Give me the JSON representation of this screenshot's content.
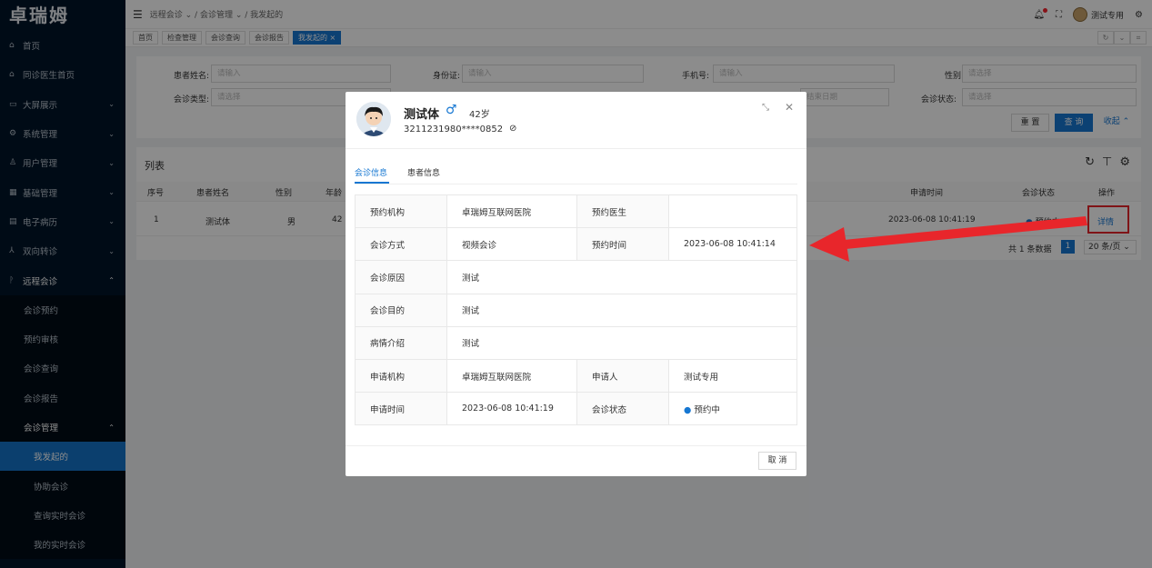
{
  "app": {
    "logo": "卓瑞姆"
  },
  "sidebar": {
    "items": [
      {
        "label": "首页",
        "icon": "home-icon"
      },
      {
        "label": "同诊医生首页",
        "icon": "home-icon"
      },
      {
        "label": "大屏展示",
        "icon": "monitor-icon"
      },
      {
        "label": "系统管理",
        "icon": "gear-icon"
      },
      {
        "label": "用户管理",
        "icon": "user-icon"
      },
      {
        "label": "基础管理",
        "icon": "grid-icon"
      },
      {
        "label": "电子病历",
        "icon": "record-icon"
      },
      {
        "label": "双向转诊",
        "icon": "transfer-icon"
      },
      {
        "label": "远程会诊",
        "icon": "branch-icon"
      },
      {
        "label": "会诊预约"
      },
      {
        "label": "预约审核"
      },
      {
        "label": "会诊查询"
      },
      {
        "label": "会诊报告"
      },
      {
        "label": "会诊管理"
      },
      {
        "label": "我发起的"
      },
      {
        "label": "协助会诊"
      },
      {
        "label": "查询实时会诊"
      },
      {
        "label": "我的实时会诊"
      }
    ]
  },
  "topbar": {
    "breadcrumb": [
      "远程会诊",
      "会诊管理",
      "我发起的"
    ],
    "username": "测试专用"
  },
  "tabs": [
    "首页",
    "检查管理",
    "会诊查询",
    "会诊报告",
    "我发起的"
  ],
  "search": {
    "patient_name_label": "患者姓名:",
    "id_label": "身份证:",
    "phone_label": "手机号:",
    "gender_label": "性别:",
    "type_label": "会诊类型:",
    "status_label": "会诊状态:",
    "input_placeholder": "请输入",
    "select_placeholder": "请选择",
    "end_date_placeholder": "结束日期",
    "reset": "重 置",
    "query": "查 询",
    "collapse": "收起"
  },
  "list": {
    "title": "列表",
    "headers": [
      "序号",
      "患者姓名",
      "性别",
      "年龄",
      "申请时间",
      "会诊状态",
      "操作"
    ],
    "row": {
      "index": "1",
      "name": "测试体",
      "gender": "男",
      "age": "42",
      "apply_time": "2023-06-08 10:41:19",
      "status": "预约中",
      "action": "详情"
    },
    "total": "共 1 条数据",
    "page": "1",
    "page_size": "20 条/页"
  },
  "modal": {
    "name": "测试体",
    "age": "42岁",
    "id_number": "3211231980****0852",
    "tabs": [
      "会诊信息",
      "患者信息"
    ],
    "rows": [
      {
        "k1": "预约机构",
        "v1": "卓瑞姆互联网医院",
        "k2": "预约医生",
        "v2": ""
      },
      {
        "k1": "会诊方式",
        "v1": "视频会诊",
        "k2": "预约时间",
        "v2": "2023-06-08 10:41:14"
      },
      {
        "k1": "会诊原因",
        "v1": "测试"
      },
      {
        "k1": "会诊目的",
        "v1": "测试"
      },
      {
        "k1": "病情介绍",
        "v1": "测试"
      },
      {
        "k1": "申请机构",
        "v1": "卓瑞姆互联网医院",
        "k2": "申请人",
        "v2": "测试专用"
      },
      {
        "k1": "申请时间",
        "v1": "2023-06-08 10:41:19",
        "k2": "会诊状态",
        "v2": "预约中"
      }
    ],
    "cancel": "取 消"
  },
  "colors": {
    "primary": "#1677d2",
    "sidebar": "#001529",
    "arrow": "#e8262b"
  }
}
